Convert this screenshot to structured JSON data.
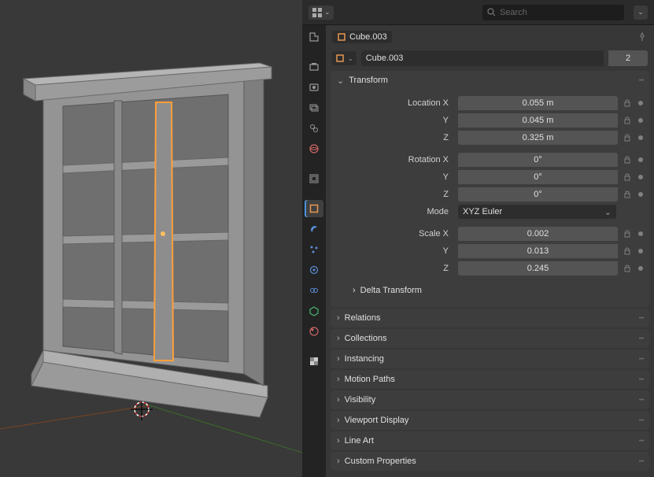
{
  "search": {
    "placeholder": "Search"
  },
  "object_name": "Cube.003",
  "data_name": "Cube.003",
  "users": "2",
  "panels": {
    "transform": {
      "title": "Transform"
    },
    "delta": {
      "title": "Delta Transform"
    },
    "relations": {
      "title": "Relations"
    },
    "collections": {
      "title": "Collections"
    },
    "instancing": {
      "title": "Instancing"
    },
    "motion_paths": {
      "title": "Motion Paths"
    },
    "visibility": {
      "title": "Visibility"
    },
    "viewport_display": {
      "title": "Viewport Display"
    },
    "line_art": {
      "title": "Line Art"
    },
    "custom_props": {
      "title": "Custom Properties"
    }
  },
  "transform": {
    "location": {
      "label_x": "Location X",
      "label_y": "Y",
      "label_z": "Z",
      "x": "0.055 m",
      "y": "0.045 m",
      "z": "0.325 m"
    },
    "rotation": {
      "label_x": "Rotation X",
      "label_y": "Y",
      "label_z": "Z",
      "x": "0°",
      "y": "0°",
      "z": "0°"
    },
    "mode": {
      "label": "Mode",
      "value": "XYZ Euler"
    },
    "scale": {
      "label_x": "Scale X",
      "label_y": "Y",
      "label_z": "Z",
      "x": "0.002",
      "y": "0.013",
      "z": "0.245"
    }
  }
}
